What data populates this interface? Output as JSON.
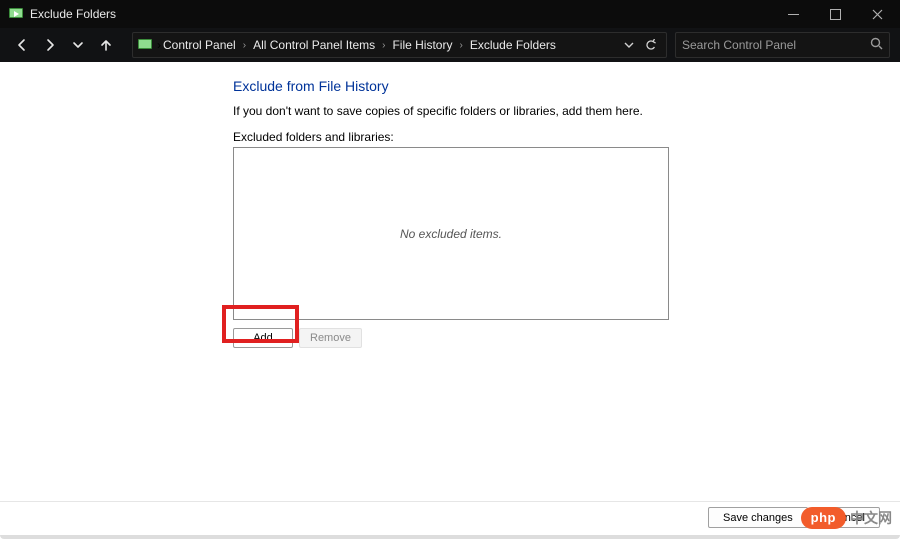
{
  "window": {
    "title": "Exclude Folders"
  },
  "breadcrumb": {
    "items": [
      "Control Panel",
      "All Control Panel Items",
      "File History",
      "Exclude Folders"
    ]
  },
  "search": {
    "placeholder": "Search Control Panel"
  },
  "page": {
    "heading": "Exclude from File History",
    "description": "If you don't want to save copies of specific folders or libraries, add them here.",
    "list_label": "Excluded folders and libraries:",
    "empty_text": "No excluded items.",
    "add_button": "Add",
    "remove_button": "Remove"
  },
  "footer": {
    "save": "Save changes",
    "cancel": "Cancel"
  },
  "watermark": {
    "badge": "php",
    "text": "中文网"
  }
}
